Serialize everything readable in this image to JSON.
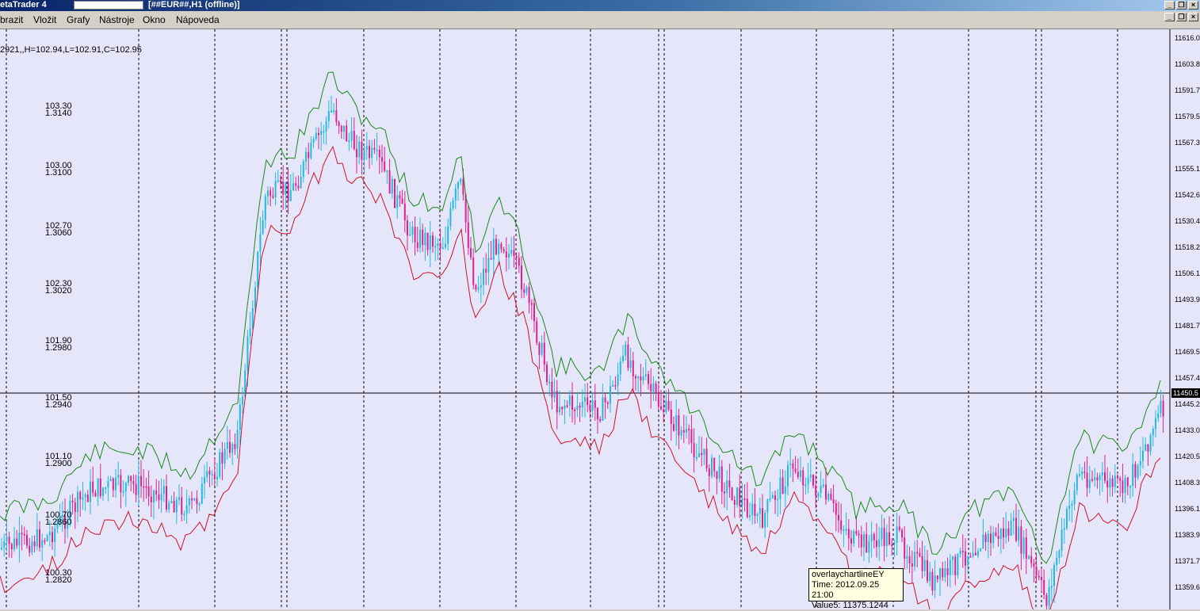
{
  "window": {
    "app_title": "etaTrader 4",
    "doc_title": "[##EUR##,H1 (offline)]",
    "controls": [
      "_",
      "❐",
      "×"
    ]
  },
  "menu": [
    "brazit",
    "Vložit",
    "Grafy",
    "Nástroje",
    "Okno",
    "Nápoveda"
  ],
  "chart": {
    "ohlc_line": "2921,,H=102.94,L=102.91,C=102.95",
    "left_scale_a": [
      "103.30",
      "103.00",
      "102.70",
      "102.30",
      "101.90",
      "101.50",
      "101.10",
      "100.70",
      "100.30"
    ],
    "left_scale_b": [
      "1.3140",
      "1.3100",
      "1.3060",
      "1.3020",
      "1.2980",
      "1.2940",
      "1.2900",
      "1.2860",
      "1.2820"
    ],
    "right_ticks": [
      "11616.0",
      "11603.8",
      "11591.7",
      "11579.5",
      "11567.3",
      "11555.1",
      "11542.6",
      "11530.4",
      "11518.2",
      "11506.1",
      "11493.9",
      "11481.7",
      "11469.5",
      "11457.4",
      "11445.2",
      "11433.0",
      "11420.5",
      "11408.3",
      "11396.1",
      "11383.9",
      "11371.7",
      "11359.6"
    ],
    "current_price": "11450.5",
    "colors": {
      "background": "#e6e6fa",
      "bull": "#22b8e0",
      "bear": "#e0208c",
      "upper_line": "#1a8a1a",
      "lower_line": "#d0102a"
    }
  },
  "tooltip": {
    "line1": "overlaychartlineEY",
    "line2": "Time: 2012.09.25 21:00",
    "line3": "Value5: 11375.1244"
  }
}
